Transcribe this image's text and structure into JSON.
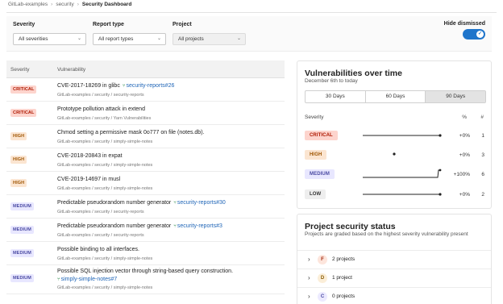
{
  "breadcrumb": {
    "items": [
      "GitLab-examples",
      "security",
      "Security Dashboard"
    ]
  },
  "filters": {
    "severity": {
      "label": "Severity",
      "value": "All severities"
    },
    "report_type": {
      "label": "Report type",
      "value": "All report types"
    },
    "project": {
      "label": "Project",
      "value": "All projects"
    },
    "hide_dismissed": {
      "label": "Hide dismissed",
      "on": true
    }
  },
  "list": {
    "headers": {
      "severity": "Severity",
      "vulnerability": "Vulnerability"
    },
    "rows": [
      {
        "severity": "CRITICAL",
        "title": "CVE-2017-18269 in glibc",
        "link": "security-reports#26",
        "link2": "",
        "path": "GitLab-examples / security / security-reports"
      },
      {
        "severity": "CRITICAL",
        "title": "Prototype pollution attack in extend",
        "link": "",
        "link2": "",
        "path": "GitLab-examples / security / Yarn Vulnerabilities"
      },
      {
        "severity": "HIGH",
        "title": "Chmod setting a permissive mask 0o777 on file (notes.db).",
        "link": "",
        "link2": "",
        "path": "GitLab-examples / security / simply-simple-notes"
      },
      {
        "severity": "HIGH",
        "title": "CVE-2018-20843 in expat",
        "link": "",
        "link2": "",
        "path": "GitLab-examples / security / simply-simple-notes"
      },
      {
        "severity": "HIGH",
        "title": "CVE-2019-14697 in musl",
        "link": "",
        "link2": "",
        "path": "GitLab-examples / security / simply-simple-notes"
      },
      {
        "severity": "MEDIUM",
        "title": "Predictable pseudorandom number generator",
        "link": "security-reports#30",
        "link2": "",
        "path": "GitLab-examples / security / security-reports"
      },
      {
        "severity": "MEDIUM",
        "title": "Predictable pseudorandom number generator",
        "link": "security-reports#3",
        "link2": "",
        "path": "GitLab-examples / security / security-reports"
      },
      {
        "severity": "MEDIUM",
        "title": "Possible binding to all interfaces.",
        "link": "",
        "link2": "",
        "path": "GitLab-examples / security / simply-simple-notes"
      },
      {
        "severity": "MEDIUM",
        "title": "Possible SQL injection vector through string-based query construction.",
        "link": "",
        "link2": "simply-simple-notes#7",
        "path": "GitLab-examples / security / simply-simple-notes"
      }
    ]
  },
  "over_time": {
    "title": "Vulnerabilities over time",
    "subtitle": "December 6th to today",
    "ranges": [
      "30 Days",
      "60 Days",
      "90 Days"
    ],
    "selected_range": "90 Days",
    "headers": {
      "severity": "Severity",
      "pct": "%",
      "count": "#"
    },
    "rows": [
      {
        "severity": "CRITICAL",
        "pct": "+0%",
        "count": "1"
      },
      {
        "severity": "HIGH",
        "pct": "+0%",
        "count": "3"
      },
      {
        "severity": "MEDIUM",
        "pct": "+100%",
        "count": "6"
      },
      {
        "severity": "LOW",
        "pct": "+0%",
        "count": "2"
      }
    ]
  },
  "project_status": {
    "title": "Project security status",
    "subtitle": "Projects are graded based on the highest severity vulnerability present",
    "grades": [
      {
        "grade": "F",
        "text": "2 projects"
      },
      {
        "grade": "D",
        "text": "1 project"
      },
      {
        "grade": "C",
        "text": "0 projects"
      }
    ]
  },
  "icons": {
    "chevron": "chevron-down-icon",
    "merge": "merge-request-icon",
    "expand": "chevron-right-icon",
    "check": "check-icon"
  }
}
